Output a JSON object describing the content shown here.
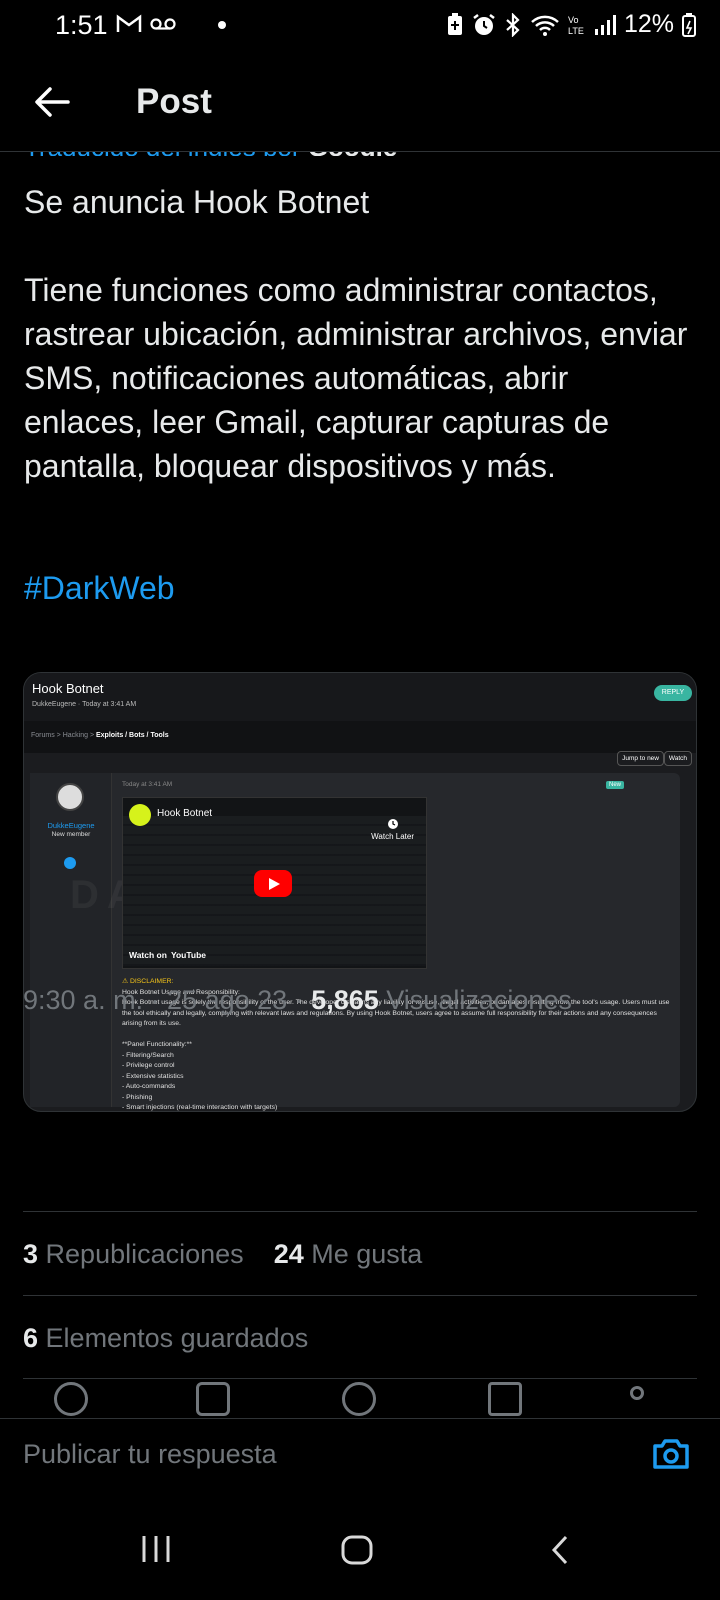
{
  "status_bar": {
    "time": "1:51",
    "battery": "12%"
  },
  "header": {
    "title": "Post"
  },
  "post": {
    "translated_label": "Traducido del inglés por",
    "translated_by": "Google",
    "text": "Se anuncia Hook Botnet\n\nTiene funciones como administrar contactos, rastrear ubicación, administrar archivos, enviar SMS, notificaciones automáticas, abrir enlaces, leer Gmail, capturar capturas de pantalla, bloquear dispositivos y más.",
    "hashtag": "#DarkWeb",
    "timestamp": "9:30 a. m. · 25 ago 23 ·",
    "views_count": "5,865",
    "views_label": "Visualizaciones",
    "reposts_count": "3",
    "reposts_label": "Republicaciones",
    "likes_count": "24",
    "likes_label": "Me gusta",
    "bookmarks_count": "6",
    "bookmarks_label": "Elementos guardados"
  },
  "media": {
    "title": "Hook Botnet",
    "meta": "DukkeEugene · Today at 3:41 AM",
    "reply_label": "REPLY",
    "breadcrumb_forums": "Forums",
    "breadcrumb_hacking": "Hacking",
    "breadcrumb_section": "Exploits / Bots / Tools",
    "jump_label": "Jump to new",
    "watch_label": "Watch",
    "username": "DukkeEugene",
    "user_role": "New member",
    "post_date": "Today at 3:41 AM",
    "new_badge": "New",
    "video_title": "Hook Botnet",
    "watch_later": "Watch Later",
    "watch_on": "Watch on",
    "youtube": "YouTube",
    "watermark": "DARK WEB",
    "disclaimer_title": "⚠ DISCLAIMER:",
    "body": "Hook Botnet Usage and Responsibility:\nHook Botnet usage is solely the responsibility of the user. The developer disclaims any liability for misuse, illegal activities, or damages resulting from the tool's usage. Users must use the tool ethically and legally, complying with relevant laws and regulations. By using Hook Botnet, users agree to assume full responsibility for their actions and any consequences arising from its use.\n\n**Panel Functionality:**\n- Filtering/Search\n- Privilege control\n- Extensive statistics\n- Auto-commands\n- Phishing\n- Smart injections (real-time interaction with targets)"
  },
  "reply": {
    "placeholder": "Publicar tu respuesta"
  },
  "colors": {
    "accent": "#1d9bf0",
    "background": "#000000",
    "muted": "#71767b"
  }
}
